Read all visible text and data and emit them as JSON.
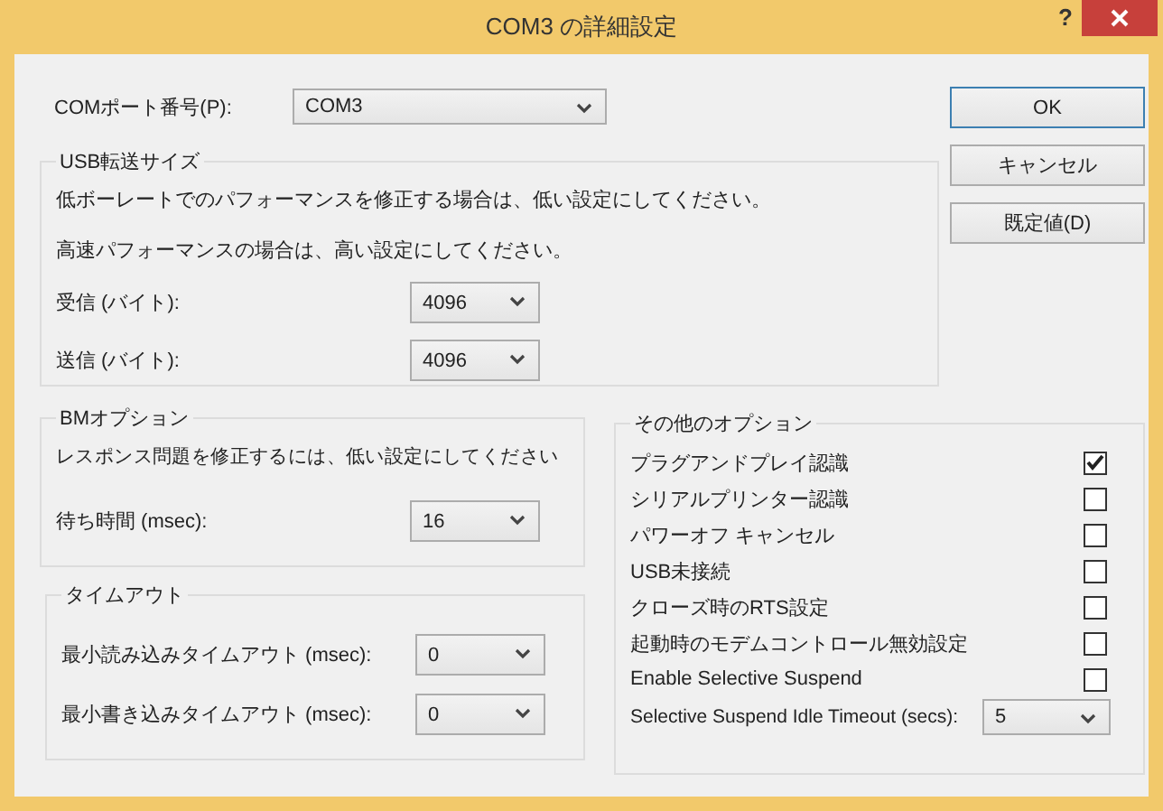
{
  "window": {
    "title": "COM3 の詳細設定",
    "help": "?"
  },
  "com_port": {
    "label": "COMポート番号(P):",
    "value": "COM3"
  },
  "buttons": [
    {
      "label": "OK",
      "default": true
    },
    {
      "label": "キャンセル",
      "default": false
    },
    {
      "label": "既定値(D)",
      "default": false
    }
  ],
  "usb_transfer": {
    "title": "USB転送サイズ",
    "notes": [
      "低ボーレートでのパフォーマンスを修正する場合は、低い設定にしてください。",
      "高速パフォーマンスの場合は、高い設定にしてください。"
    ],
    "fields": [
      {
        "label": "受信 (バイト):",
        "value": "4096"
      },
      {
        "label": "送信 (バイト):",
        "value": "4096"
      }
    ]
  },
  "bm_options": {
    "title": "BMオプション",
    "note": "レスポンス問題を修正するには、低い設定にしてください",
    "fields": [
      {
        "label": "待ち時間 (msec):",
        "value": "16"
      }
    ]
  },
  "timeouts": {
    "title": "タイムアウト",
    "fields": [
      {
        "label": "最小読み込みタイムアウト (msec):",
        "value": "0"
      },
      {
        "label": "最小書き込みタイムアウト (msec):",
        "value": "0"
      }
    ]
  },
  "other_options": {
    "title": "その他のオプション",
    "items": [
      {
        "kind": "checkbox",
        "label": "プラグアンドプレイ認識",
        "checked": true
      },
      {
        "kind": "checkbox",
        "label": "シリアルプリンター認識",
        "checked": false
      },
      {
        "kind": "checkbox",
        "label": "パワーオフ キャンセル",
        "checked": false
      },
      {
        "kind": "checkbox",
        "label": "USB未接続",
        "checked": false
      },
      {
        "kind": "checkbox",
        "label": "クローズ時のRTS設定",
        "checked": false
      },
      {
        "kind": "checkbox",
        "label": "起動時のモデムコントロール無効設定",
        "checked": false
      },
      {
        "kind": "checkbox",
        "label": "Enable Selective Suspend",
        "checked": false
      },
      {
        "kind": "dropdown",
        "label": "Selective Suspend Idle Timeout (secs):",
        "value": "5"
      }
    ]
  }
}
